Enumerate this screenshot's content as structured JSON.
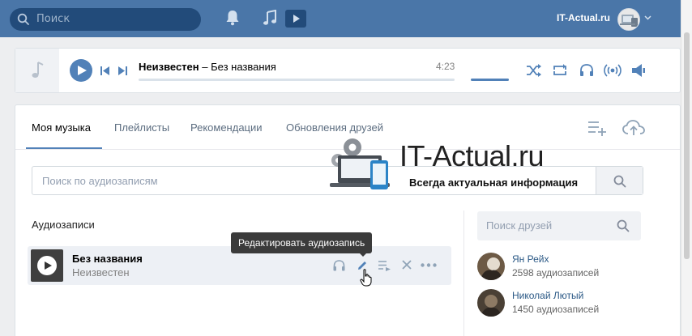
{
  "topbar": {
    "search_placeholder": "Поиск",
    "site_name": "IT-Actual.ru"
  },
  "player": {
    "track_artist": "Неизвестен",
    "track_separator": " – ",
    "track_title": "Без названия",
    "duration": "4:23"
  },
  "tabs": [
    {
      "label": "Моя музыка",
      "active": true
    },
    {
      "label": "Плейлисты",
      "active": false
    },
    {
      "label": "Рекомендации",
      "active": false
    },
    {
      "label": "Обновления друзей",
      "active": false
    }
  ],
  "audio_search": {
    "placeholder": "Поиск по аудиозаписям"
  },
  "watermark": {
    "title": "IT-Actual.ru",
    "subtitle": "Всегда актуальная информация"
  },
  "section_title": "Аудиозаписи",
  "audio_row": {
    "title": "Без названия",
    "artist": "Неизвестен"
  },
  "tooltip": "Редактировать аудиозапись",
  "friends_search": {
    "placeholder": "Поиск друзей"
  },
  "friends": [
    {
      "name": "Ян Рейх",
      "count": "2598 аудиозаписей"
    },
    {
      "name": "Николай Лютый",
      "count": "1450 аудиозаписей"
    }
  ],
  "colors": {
    "brand": "#4a76a8",
    "accent": "#5181b8"
  }
}
